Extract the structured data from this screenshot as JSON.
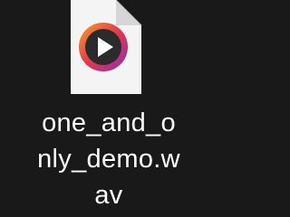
{
  "desktop": {
    "file": {
      "icon": "media-player-file-icon",
      "name_lines": [
        "one_and_o",
        "nly_demo.w",
        "av"
      ]
    }
  },
  "colors": {
    "background": "#191919",
    "document": "#f4f4f4",
    "ring_gradient": [
      "#f2a12a",
      "#e5374d",
      "#8a2fb5"
    ],
    "play_disc": "#2b2b2b",
    "play_triangle": "#ffffff",
    "label": "#ffffff"
  }
}
